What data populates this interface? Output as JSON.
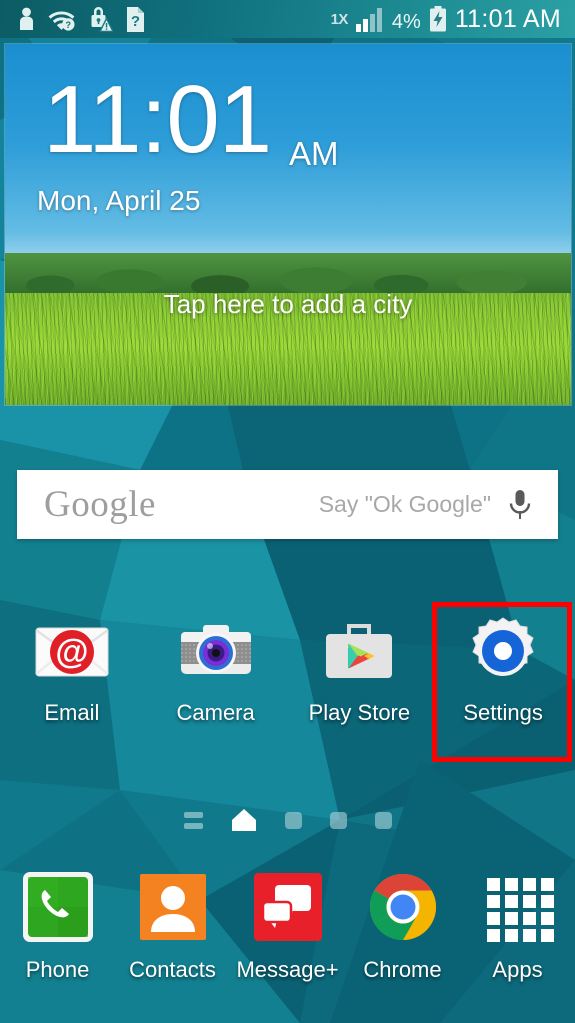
{
  "status_bar": {
    "left_icons": [
      {
        "name": "person-icon",
        "label": "person"
      },
      {
        "name": "wifi-question-icon",
        "label": "wifi-unknown"
      },
      {
        "name": "lock-warning-icon",
        "label": "lock-warning"
      },
      {
        "name": "document-question-icon",
        "label": "document-unknown"
      }
    ],
    "network_type": "1X",
    "signal_icon": "signal-bars-icon",
    "signal_bars_filled": 2,
    "signal_bars_total": 4,
    "battery_percent": "4%",
    "battery_icon": "battery-charging-icon",
    "clock": "11:01 AM"
  },
  "weather_widget": {
    "time": "11:01",
    "ampm": "AM",
    "date": "Mon, April 25",
    "add_city_prompt": "Tap here to add a city"
  },
  "search": {
    "wordmark": "Google",
    "hint": "Say \"Ok Google\"",
    "placeholder": "Say \"Ok Google\"",
    "mic_icon": "microphone-icon"
  },
  "app_grid": [
    {
      "label": "Email",
      "icon": "email-icon"
    },
    {
      "label": "Camera",
      "icon": "camera-icon"
    },
    {
      "label": "Play Store",
      "icon": "play-store-icon"
    },
    {
      "label": "Settings",
      "icon": "settings-gear-icon",
      "highlighted": true
    }
  ],
  "highlight": {
    "color": "#ff0000",
    "target": "Settings"
  },
  "page_indicator": {
    "items": [
      "briefing",
      "home",
      "dot",
      "dot",
      "dot"
    ],
    "active_index": 1
  },
  "dock": [
    {
      "label": "Phone",
      "icon": "phone-icon"
    },
    {
      "label": "Contacts",
      "icon": "contacts-icon"
    },
    {
      "label": "Message+",
      "icon": "message-plus-icon"
    },
    {
      "label": "Chrome",
      "icon": "chrome-icon"
    },
    {
      "label": "Apps",
      "icon": "apps-grid-icon"
    }
  ],
  "colors": {
    "wallpaper_base": "#0e7286",
    "status_bar": "#10707e",
    "highlight_red": "#ff0000",
    "email_red": "#e01f26",
    "phone_green": "#31a925",
    "contacts_orange": "#f58220",
    "message_red": "#e8202a",
    "settings_blue": "#1565d8"
  }
}
